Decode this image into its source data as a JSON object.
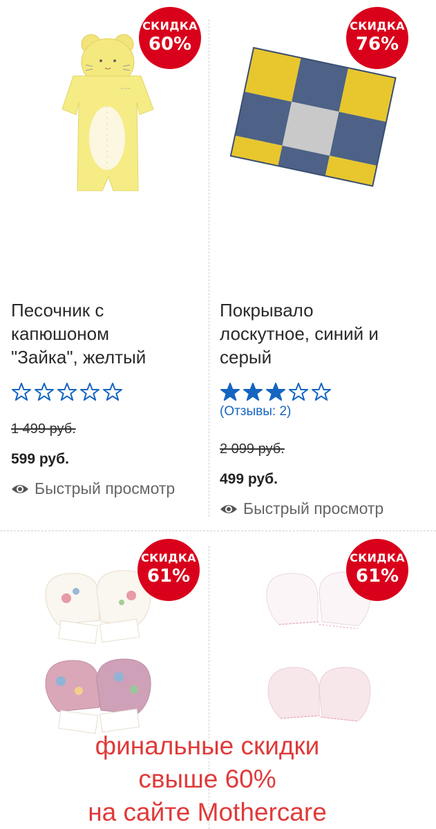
{
  "products": [
    {
      "badge_label": "СКИДКА",
      "badge_percent": "60%",
      "title_lines": [
        "Песочник с",
        "капюшоном",
        "\"Зайка\", желтый"
      ],
      "rating": 0,
      "reviews": "",
      "old_price": "1 499 руб.",
      "price": "599 руб.",
      "quick_view": "Быстрый просмотр"
    },
    {
      "badge_label": "СКИДКА",
      "badge_percent": "76%",
      "title_lines": [
        "Покрывало",
        "лоскутное, синий и",
        "серый"
      ],
      "rating": 3,
      "reviews": "(Отзывы: 2)",
      "old_price": "2 099 руб.",
      "price": "499 руб.",
      "quick_view": "Быстрый просмотр"
    },
    {
      "badge_label": "СКИДКА",
      "badge_percent": "61%"
    },
    {
      "badge_label": "СКИДКА",
      "badge_percent": "61%"
    }
  ],
  "promo": {
    "line1": "финальные скидки",
    "line2": "свыше 60%",
    "line3": "на сайте Mothercare"
  },
  "colors": {
    "badge": "#d9001b",
    "star": "#1565c0",
    "promo_text": "#e03a3a"
  }
}
